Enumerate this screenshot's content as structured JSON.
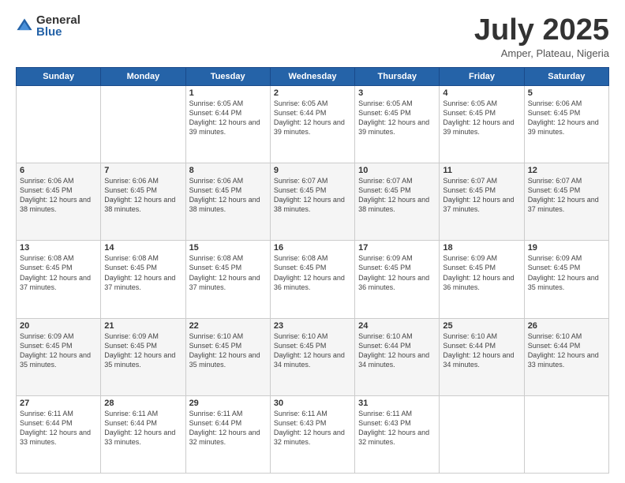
{
  "header": {
    "logo_general": "General",
    "logo_blue": "Blue",
    "month_title": "July 2025",
    "subtitle": "Amper, Plateau, Nigeria"
  },
  "days_of_week": [
    "Sunday",
    "Monday",
    "Tuesday",
    "Wednesday",
    "Thursday",
    "Friday",
    "Saturday"
  ],
  "weeks": [
    [
      {
        "day": "",
        "info": ""
      },
      {
        "day": "",
        "info": ""
      },
      {
        "day": "1",
        "info": "Sunrise: 6:05 AM\nSunset: 6:44 PM\nDaylight: 12 hours and 39 minutes."
      },
      {
        "day": "2",
        "info": "Sunrise: 6:05 AM\nSunset: 6:44 PM\nDaylight: 12 hours and 39 minutes."
      },
      {
        "day": "3",
        "info": "Sunrise: 6:05 AM\nSunset: 6:45 PM\nDaylight: 12 hours and 39 minutes."
      },
      {
        "day": "4",
        "info": "Sunrise: 6:05 AM\nSunset: 6:45 PM\nDaylight: 12 hours and 39 minutes."
      },
      {
        "day": "5",
        "info": "Sunrise: 6:06 AM\nSunset: 6:45 PM\nDaylight: 12 hours and 39 minutes."
      }
    ],
    [
      {
        "day": "6",
        "info": "Sunrise: 6:06 AM\nSunset: 6:45 PM\nDaylight: 12 hours and 38 minutes."
      },
      {
        "day": "7",
        "info": "Sunrise: 6:06 AM\nSunset: 6:45 PM\nDaylight: 12 hours and 38 minutes."
      },
      {
        "day": "8",
        "info": "Sunrise: 6:06 AM\nSunset: 6:45 PM\nDaylight: 12 hours and 38 minutes."
      },
      {
        "day": "9",
        "info": "Sunrise: 6:07 AM\nSunset: 6:45 PM\nDaylight: 12 hours and 38 minutes."
      },
      {
        "day": "10",
        "info": "Sunrise: 6:07 AM\nSunset: 6:45 PM\nDaylight: 12 hours and 38 minutes."
      },
      {
        "day": "11",
        "info": "Sunrise: 6:07 AM\nSunset: 6:45 PM\nDaylight: 12 hours and 37 minutes."
      },
      {
        "day": "12",
        "info": "Sunrise: 6:07 AM\nSunset: 6:45 PM\nDaylight: 12 hours and 37 minutes."
      }
    ],
    [
      {
        "day": "13",
        "info": "Sunrise: 6:08 AM\nSunset: 6:45 PM\nDaylight: 12 hours and 37 minutes."
      },
      {
        "day": "14",
        "info": "Sunrise: 6:08 AM\nSunset: 6:45 PM\nDaylight: 12 hours and 37 minutes."
      },
      {
        "day": "15",
        "info": "Sunrise: 6:08 AM\nSunset: 6:45 PM\nDaylight: 12 hours and 37 minutes."
      },
      {
        "day": "16",
        "info": "Sunrise: 6:08 AM\nSunset: 6:45 PM\nDaylight: 12 hours and 36 minutes."
      },
      {
        "day": "17",
        "info": "Sunrise: 6:09 AM\nSunset: 6:45 PM\nDaylight: 12 hours and 36 minutes."
      },
      {
        "day": "18",
        "info": "Sunrise: 6:09 AM\nSunset: 6:45 PM\nDaylight: 12 hours and 36 minutes."
      },
      {
        "day": "19",
        "info": "Sunrise: 6:09 AM\nSunset: 6:45 PM\nDaylight: 12 hours and 35 minutes."
      }
    ],
    [
      {
        "day": "20",
        "info": "Sunrise: 6:09 AM\nSunset: 6:45 PM\nDaylight: 12 hours and 35 minutes."
      },
      {
        "day": "21",
        "info": "Sunrise: 6:09 AM\nSunset: 6:45 PM\nDaylight: 12 hours and 35 minutes."
      },
      {
        "day": "22",
        "info": "Sunrise: 6:10 AM\nSunset: 6:45 PM\nDaylight: 12 hours and 35 minutes."
      },
      {
        "day": "23",
        "info": "Sunrise: 6:10 AM\nSunset: 6:45 PM\nDaylight: 12 hours and 34 minutes."
      },
      {
        "day": "24",
        "info": "Sunrise: 6:10 AM\nSunset: 6:44 PM\nDaylight: 12 hours and 34 minutes."
      },
      {
        "day": "25",
        "info": "Sunrise: 6:10 AM\nSunset: 6:44 PM\nDaylight: 12 hours and 34 minutes."
      },
      {
        "day": "26",
        "info": "Sunrise: 6:10 AM\nSunset: 6:44 PM\nDaylight: 12 hours and 33 minutes."
      }
    ],
    [
      {
        "day": "27",
        "info": "Sunrise: 6:11 AM\nSunset: 6:44 PM\nDaylight: 12 hours and 33 minutes."
      },
      {
        "day": "28",
        "info": "Sunrise: 6:11 AM\nSunset: 6:44 PM\nDaylight: 12 hours and 33 minutes."
      },
      {
        "day": "29",
        "info": "Sunrise: 6:11 AM\nSunset: 6:44 PM\nDaylight: 12 hours and 32 minutes."
      },
      {
        "day": "30",
        "info": "Sunrise: 6:11 AM\nSunset: 6:43 PM\nDaylight: 12 hours and 32 minutes."
      },
      {
        "day": "31",
        "info": "Sunrise: 6:11 AM\nSunset: 6:43 PM\nDaylight: 12 hours and 32 minutes."
      },
      {
        "day": "",
        "info": ""
      },
      {
        "day": "",
        "info": ""
      }
    ]
  ]
}
